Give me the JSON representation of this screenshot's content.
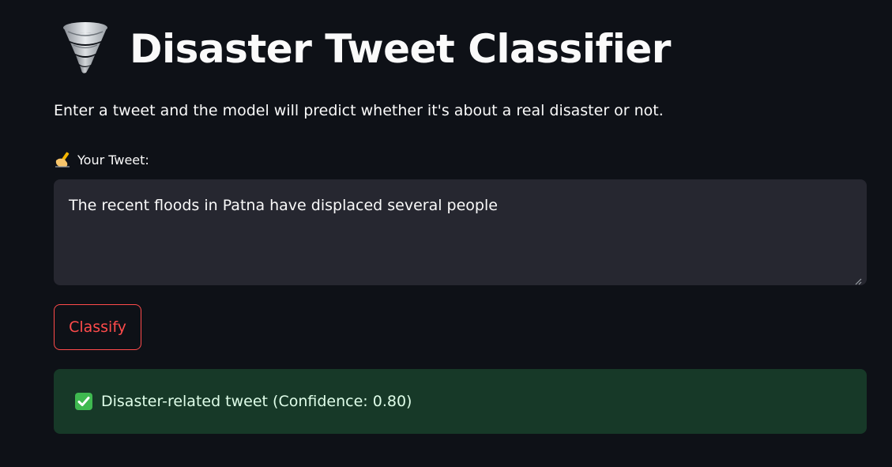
{
  "header": {
    "title": "Disaster Tweet Classifier",
    "title_icon": "tornado-icon"
  },
  "description": "Enter a tweet and the model will predict whether it's about a real disaster or not.",
  "input": {
    "label": "Your Tweet:",
    "label_icon": "writing-hand-icon",
    "value": "The recent floods in Patna have displaced several people"
  },
  "actions": {
    "classify_label": "Classify"
  },
  "result": {
    "icon": "check-mark-icon",
    "text": "Disaster-related tweet (Confidence: 0.80)",
    "status_color": "#173928"
  },
  "theme": {
    "background": "#0e1117",
    "accent": "#ff4b4b",
    "input_background": "#262730"
  }
}
